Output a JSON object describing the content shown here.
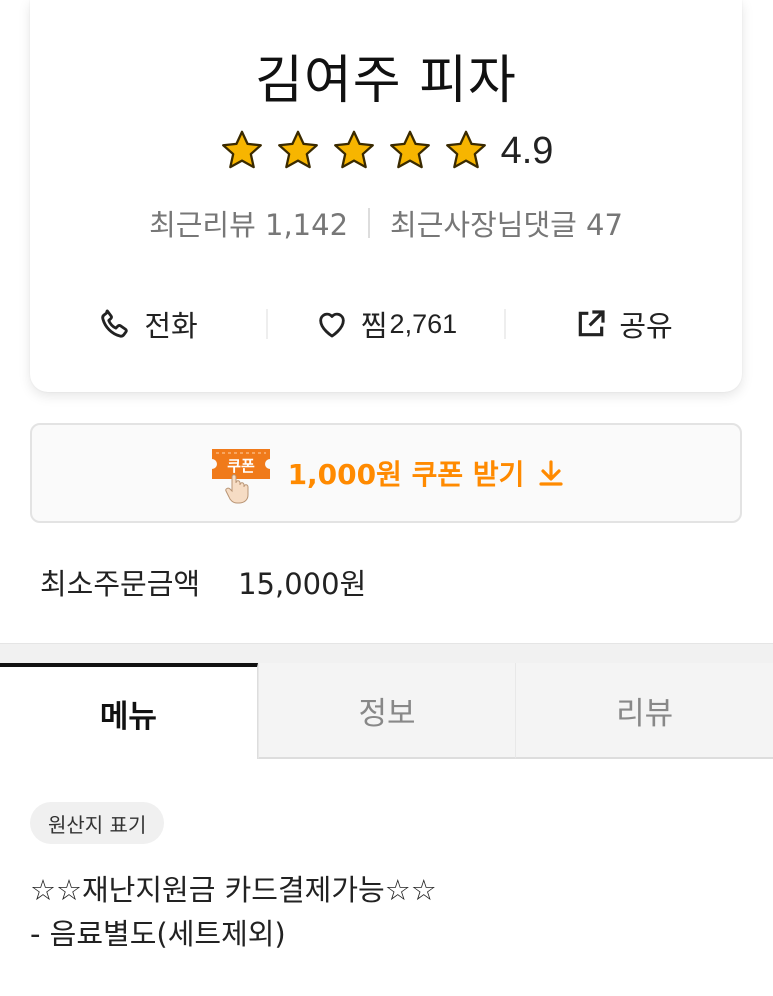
{
  "store": {
    "name": "김여주 피자",
    "rating": "4.9",
    "rating_stars": 5,
    "recent_reviews_label": "최근리뷰",
    "recent_reviews_count": "1,142",
    "owner_comments_label": "최근사장님댓글",
    "owner_comments_count": "47"
  },
  "actions": {
    "call_label": "전화",
    "like_label": "찜",
    "like_count": "2,761",
    "share_label": "공유"
  },
  "coupon": {
    "ticket_text": "쿠폰",
    "label": "1,000원 쿠폰 받기"
  },
  "min_order": {
    "label": "최소주문금액",
    "value": "15,000원"
  },
  "tabs": [
    {
      "label": "메뉴"
    },
    {
      "label": "정보"
    },
    {
      "label": "리뷰"
    }
  ],
  "menu": {
    "origin_chip": "원산지 표기",
    "notice_line1": "☆☆재난지원금 카드결제가능☆☆",
    "notice_line2": "- 음료별도(세트제외)"
  },
  "colors": {
    "accent": "#ff8a00",
    "star": "#f7b500"
  }
}
